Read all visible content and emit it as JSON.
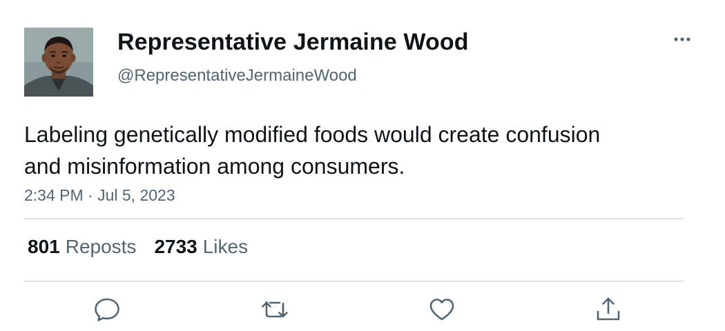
{
  "author": {
    "display_name": "Representative Jermaine Wood",
    "handle": "@RepresentativeJermaineWood",
    "avatar": "profile-photo"
  },
  "tweet": {
    "text": "Labeling genetically modified foods would create confusion and misinformation among consumers.",
    "timestamp": "2:34 PM · Jul 5, 2023"
  },
  "stats": {
    "reposts_count": "801",
    "reposts_label": "Reposts",
    "likes_count": "2733",
    "likes_label": "Likes"
  },
  "actions": [
    {
      "icon": "reply-icon"
    },
    {
      "icon": "repost-icon"
    },
    {
      "icon": "like-icon"
    },
    {
      "icon": "share-icon"
    }
  ],
  "colors": {
    "text_primary": "#0f1419",
    "text_secondary": "#536471",
    "divider": "#dfe3e6",
    "background": "#ffffff"
  }
}
